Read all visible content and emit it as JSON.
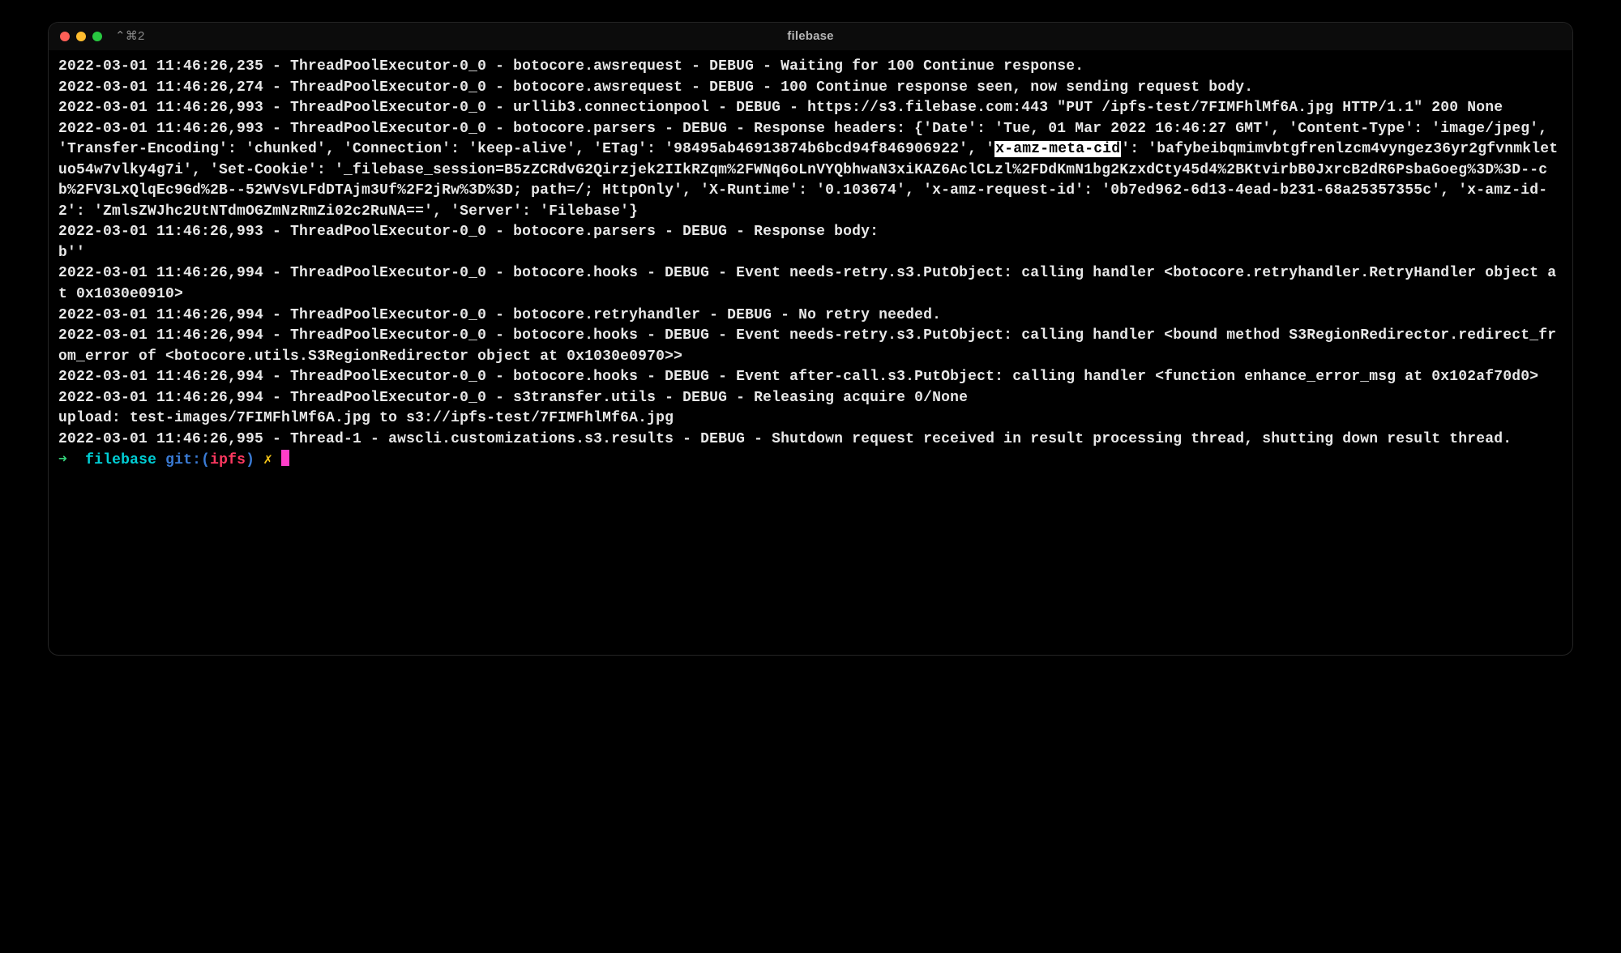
{
  "window": {
    "tab": "⌃⌘2",
    "title": "filebase"
  },
  "log": {
    "pre_hl": "2022-03-01 11:46:26,235 - ThreadPoolExecutor-0_0 - botocore.awsrequest - DEBUG - Waiting for 100 Continue response.\n2022-03-01 11:46:26,274 - ThreadPoolExecutor-0_0 - botocore.awsrequest - DEBUG - 100 Continue response seen, now sending request body.\n2022-03-01 11:46:26,993 - ThreadPoolExecutor-0_0 - urllib3.connectionpool - DEBUG - https://s3.filebase.com:443 \"PUT /ipfs-test/7FIMFhlMf6A.jpg HTTP/1.1\" 200 None\n2022-03-01 11:46:26,993 - ThreadPoolExecutor-0_0 - botocore.parsers - DEBUG - Response headers: {'Date': 'Tue, 01 Mar 2022 16:46:27 GMT', 'Content-Type': 'image/jpeg', 'Transfer-Encoding': 'chunked', 'Connection': 'keep-alive', 'ETag': '98495ab46913874b6bcd94f846906922', '",
    "highlight": "x-amz-meta-cid",
    "post_hl": "': 'bafybeibqmimvbtgfrenlzcm4vyngez36yr2gfvnmkletuo54w7vlky4g7i', 'Set-Cookie': '_filebase_session=B5zZCRdvG2Qirzjek2IIkRZqm%2FWNq6oLnVYQbhwaN3xiKAZ6AclCLzl%2FDdKmN1bg2KzxdCty45d4%2BKtvirbB0JxrcB2dR6PsbaGoeg%3D%3D--cb%2FV3LxQlqEc9Gd%2B--52WVsVLFdDTAjm3Uf%2F2jRw%3D%3D; path=/; HttpOnly', 'X-Runtime': '0.103674', 'x-amz-request-id': '0b7ed962-6d13-4ead-b231-68a25357355c', 'x-amz-id-2': 'ZmlsZWJhc2UtNTdmOGZmNzRmZi02c2RuNA==', 'Server': 'Filebase'}\n2022-03-01 11:46:26,993 - ThreadPoolExecutor-0_0 - botocore.parsers - DEBUG - Response body:\nb''\n2022-03-01 11:46:26,994 - ThreadPoolExecutor-0_0 - botocore.hooks - DEBUG - Event needs-retry.s3.PutObject: calling handler <botocore.retryhandler.RetryHandler object at 0x1030e0910>\n2022-03-01 11:46:26,994 - ThreadPoolExecutor-0_0 - botocore.retryhandler - DEBUG - No retry needed.\n2022-03-01 11:46:26,994 - ThreadPoolExecutor-0_0 - botocore.hooks - DEBUG - Event needs-retry.s3.PutObject: calling handler <bound method S3RegionRedirector.redirect_from_error of <botocore.utils.S3RegionRedirector object at 0x1030e0970>>\n2022-03-01 11:46:26,994 - ThreadPoolExecutor-0_0 - botocore.hooks - DEBUG - Event after-call.s3.PutObject: calling handler <function enhance_error_msg at 0x102af70d0>\n2022-03-01 11:46:26,994 - ThreadPoolExecutor-0_0 - s3transfer.utils - DEBUG - Releasing acquire 0/None\nupload: test-images/7FIMFhlMf6A.jpg to s3://ipfs-test/7FIMFhlMf6A.jpg\n2022-03-01 11:46:26,995 - Thread-1 - awscli.customizations.s3.results - DEBUG - Shutdown request received in result processing thread, shutting down result thread.\n"
  },
  "prompt": {
    "arrow": "➜",
    "dir": "filebase",
    "git_label": "git:(",
    "branch": "ipfs",
    "git_close": ")",
    "dirty": "✗"
  }
}
